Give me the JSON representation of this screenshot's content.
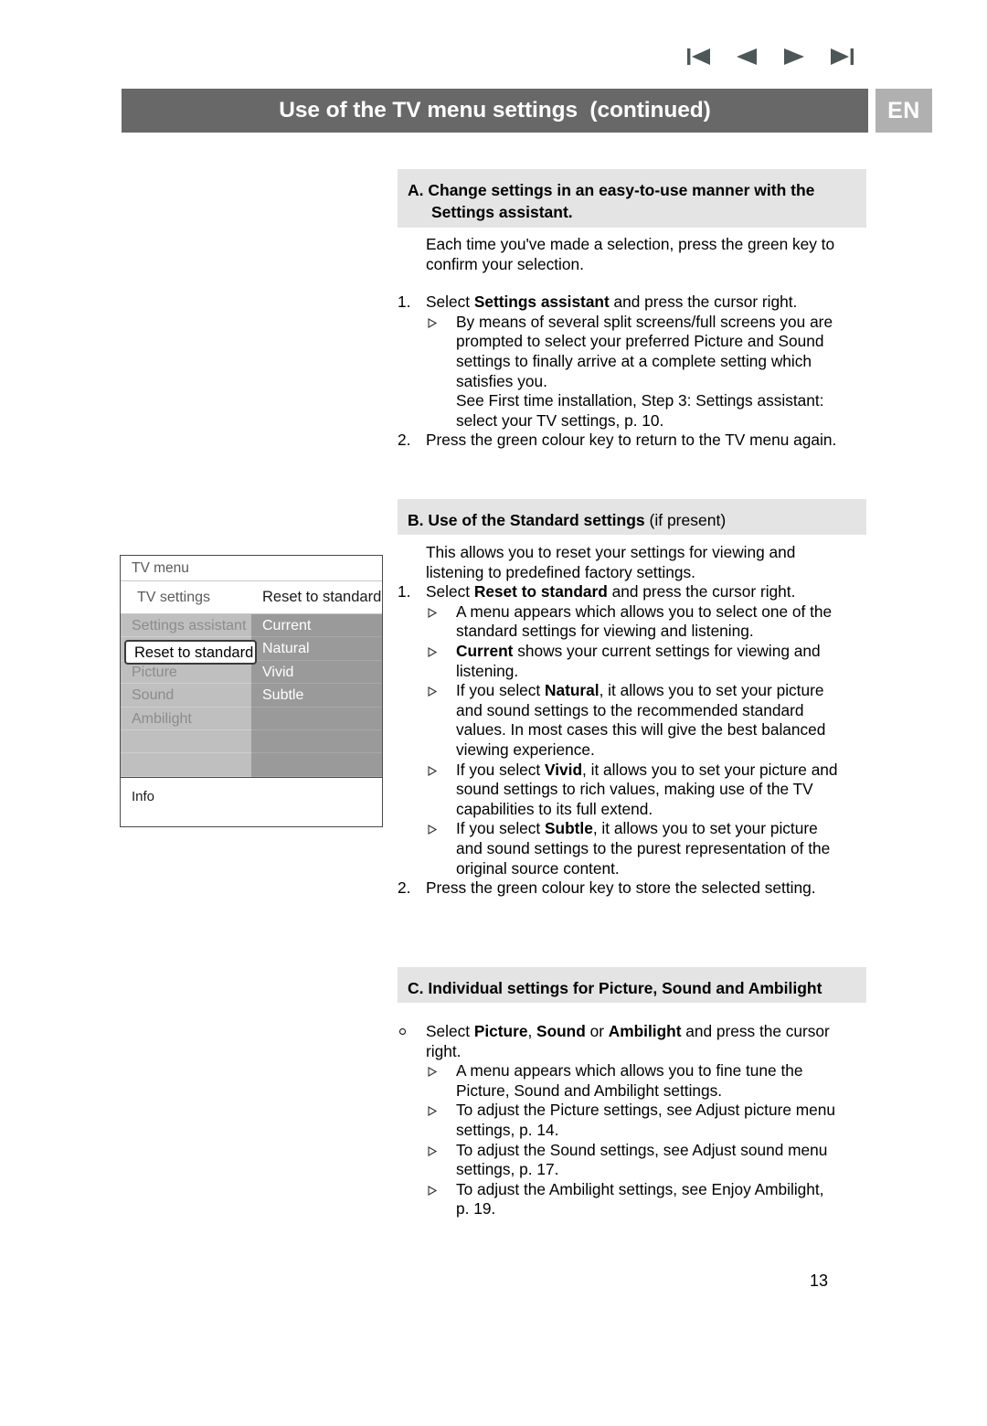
{
  "nav": {
    "icons": [
      {
        "name": "first-page-icon",
        "label": "First page"
      },
      {
        "name": "previous-page-icon",
        "label": "Previous page"
      },
      {
        "name": "next-page-icon",
        "label": "Next page"
      },
      {
        "name": "last-page-icon",
        "label": "Last page"
      }
    ],
    "color": "#4c5757"
  },
  "header": {
    "title": "Use of the TV menu settings  (continued)",
    "language_badge": "EN",
    "bar_color": "#686868",
    "badge_color": "#b0b0b0"
  },
  "sections": {
    "a": {
      "heading_line1_label": "A.",
      "heading_line1": "Change settings in an easy-to-use manner with the",
      "heading_line2": "Settings assistant.",
      "intro": "Each time you've made a selection, press the green key to\nconfirm your selection.",
      "item1_marker": "1.",
      "item1_pre": "Select ",
      "item1_bold": "Settings assistant",
      "item1_post": " and press the cursor right.",
      "item1_sub1": "By means of several split screens/full screens you are\nprompted to select your preferred Picture and Sound\nsettings to finally arrive at a complete setting which\nsatisfies you.\nSee First time installation, Step 3: Settings assistant:\nselect your TV settings, p. 10.",
      "item2_marker": "2.",
      "item2": "Press the green colour key to return to the TV menu again."
    },
    "b": {
      "heading_label": "B.",
      "heading_bold": "Use of the Standard settings",
      "heading_normal": " (if present)",
      "intro": "This allows you to reset your settings for viewing and\nlistening to predefined factory settings.",
      "item1_marker": "1.",
      "item1_pre": "Select ",
      "item1_bold": "Reset to standard",
      "item1_post": " and press the cursor right.",
      "sub1": "A menu appears which allows you to select one of the\nstandard settings for viewing and listening.",
      "sub2_bold": "Current",
      "sub2_post": " shows your current settings for viewing and\nlistening.",
      "sub3_pre": "If you select ",
      "sub3_bold": "Natural",
      "sub3_post": ", it allows you to set your picture\nand sound settings to the recommended standard\nvalues. In most cases this will give the best balanced\nviewing experience.",
      "sub4_pre": "If you select ",
      "sub4_bold": "Vivid",
      "sub4_post": ", it allows you to set your picture and\nsound settings to rich values, making use of the TV\ncapabilities to its full extend.",
      "sub5_pre": "If you select ",
      "sub5_bold": "Subtle",
      "sub5_post": ", it allows you to set your picture\nand sound settings to the purest representation of the\noriginal source content.",
      "item2_marker": "2.",
      "item2": "Press the green colour key to store the selected setting."
    },
    "c": {
      "heading_label": "C.",
      "heading": "Individual settings for Picture, Sound and Ambilight",
      "item1_pre": "Select ",
      "item1_bold1": "Picture",
      "item1_mid1": ", ",
      "item1_bold2": "Sound",
      "item1_mid2": " or ",
      "item1_bold3": "Ambilight",
      "item1_post": " and press the cursor\nright.",
      "sub1": "A menu appears which allows you to fine tune the\nPicture, Sound and Ambilight settings.",
      "sub2": "To adjust the Picture settings, see Adjust picture menu\nsettings, p. 14.",
      "sub3": "To adjust the Sound settings, see Adjust sound menu\nsettings, p. 17.",
      "sub4": "To adjust the Ambilight settings, see Enjoy Ambilight,\np. 19."
    }
  },
  "tv_menu": {
    "title": "TV menu",
    "breadcrumb_left": "TV settings",
    "breadcrumb_right": "Reset to standard",
    "left_items": [
      "Settings assistant",
      "Reset to standard",
      "Picture",
      "Sound",
      "Ambilight",
      "",
      ""
    ],
    "right_items": [
      "Current",
      "Natural",
      "Vivid",
      "Subtle",
      "",
      "",
      ""
    ],
    "selected_item": "Reset to standard",
    "info_label": "Info",
    "colors": {
      "left_column": "#bfbfbf",
      "right_column": "#9a9a9a",
      "selection_border": "#3a3a3a",
      "frame": "#4a4a4a"
    }
  },
  "footer": {
    "page_number": "13"
  }
}
